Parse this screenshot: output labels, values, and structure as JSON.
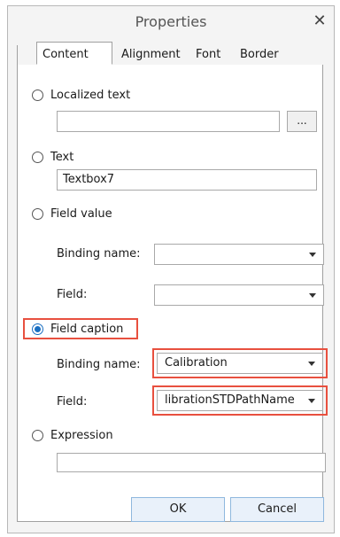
{
  "window": {
    "title": "Properties",
    "close_glyph": "✕"
  },
  "tabs": [
    {
      "label": "Content",
      "active": true
    },
    {
      "label": "Alignment",
      "active": false
    },
    {
      "label": "Font",
      "active": false
    },
    {
      "label": "Border",
      "active": false
    }
  ],
  "options": {
    "localized_text": {
      "label": "Localized text",
      "value": "",
      "browse_label": "..."
    },
    "text": {
      "label": "Text",
      "value": "Textbox7"
    },
    "field_value": {
      "label": "Field value",
      "binding_name_label": "Binding name:",
      "binding_name_value": "",
      "field_label": "Field:",
      "field_value": ""
    },
    "field_caption": {
      "label": "Field caption",
      "selected": true,
      "binding_name_label": "Binding name:",
      "binding_name_value": "Calibration",
      "field_label": "Field:",
      "field_value": "librationSTDPathName"
    },
    "expression": {
      "label": "Expression",
      "value": ""
    }
  },
  "buttons": {
    "ok": "OK",
    "cancel": "Cancel"
  },
  "colors": {
    "highlight": "#e8503f",
    "accent": "#1a6fc2"
  }
}
